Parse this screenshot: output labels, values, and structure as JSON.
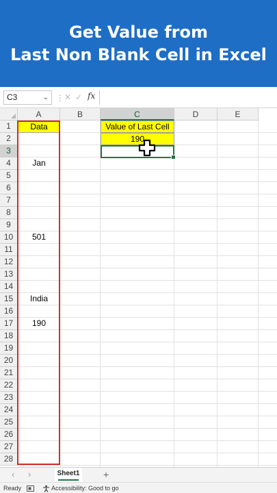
{
  "banner": {
    "line1": "Get Value from",
    "line2": "Last Non Blank Cell in Excel",
    "color": "#1e6ec6"
  },
  "formula_bar": {
    "name_box": "C3",
    "name_box_icon": "chevron-down-icon",
    "cancel_icon": "close-icon",
    "enter_icon": "check-icon",
    "fx_label": "fx",
    "formula": ""
  },
  "columns": [
    "A",
    "B",
    "C",
    "D",
    "E"
  ],
  "selected_column": "C",
  "rows": [
    "1",
    "2",
    "3",
    "4",
    "5",
    "6",
    "7",
    "8",
    "9",
    "10",
    "11",
    "12",
    "13",
    "14",
    "15",
    "16",
    "17",
    "18",
    "19",
    "20",
    "21",
    "22",
    "23",
    "24",
    "25",
    "26",
    "27",
    "28"
  ],
  "selected_row": "3",
  "cells": {
    "A1": "Data",
    "A4": "Jan",
    "A10": "501",
    "A15": "India",
    "A17": "190",
    "C1": "Value of Last Cell",
    "C2": "190"
  },
  "colors": {
    "highlight": "#ffff00",
    "outline": "#d42a2a",
    "selection": "#217346"
  },
  "cursor_icon": "cross-cursor-icon",
  "sheet_tabs": {
    "prev_icon": "chevron-left-icon",
    "next_icon": "chevron-right-icon",
    "active": "Sheet1",
    "add_icon": "plus-icon",
    "add_label": "+"
  },
  "status_bar": {
    "ready": "Ready",
    "accessibility": "Accessibility: Good to go"
  }
}
